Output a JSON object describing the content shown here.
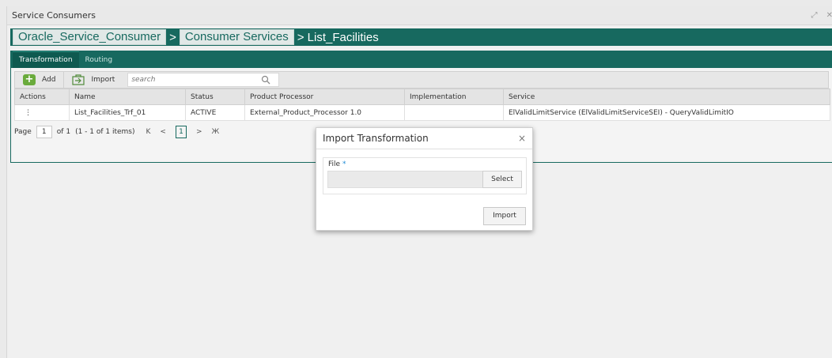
{
  "window": {
    "title": "Service Consumers"
  },
  "breadcrumb": {
    "items": [
      "Oracle_Service_Consumer",
      "Consumer Services"
    ],
    "separator": ">",
    "current": "> List_Facilities"
  },
  "tabs": [
    "Transformation",
    "Routing"
  ],
  "toolbar": {
    "add_label": "Add",
    "import_label": "Import",
    "search_placeholder": "search"
  },
  "table": {
    "headers": [
      "Actions",
      "Name",
      "Status",
      "Product Processor",
      "Implementation",
      "Service"
    ],
    "rows": [
      [
        "⋮",
        "List_Facilities_Trf_01",
        "ACTIVE",
        "External_Product_Processor 1.0",
        "",
        "ElValidLimitService (ElValidLimitServiceSEI) - QueryValidLimitIO"
      ]
    ]
  },
  "pager": {
    "page_label": "Page",
    "page_value": "1",
    "of_label": "of 1",
    "items_label": "(1 - 1 of 1 items)",
    "first": "K",
    "prev": "<",
    "current": "1",
    "next": ">",
    "last": "Ж"
  },
  "modal": {
    "title": "Import Transformation",
    "close": "×",
    "field_label": "File",
    "required_mark": "*",
    "select_label": "Select",
    "import_label": "Import"
  },
  "colors": {
    "brand": "#17695f",
    "add_green": "#6aab3c"
  }
}
